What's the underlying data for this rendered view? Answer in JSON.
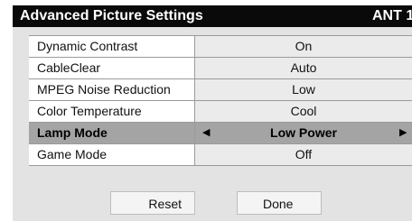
{
  "menu": {
    "title": "Advanced Picture Settings",
    "input_label": "ANT 1",
    "rows": [
      {
        "label": "Dynamic Contrast",
        "value": "On"
      },
      {
        "label": "CableClear",
        "value": "Auto"
      },
      {
        "label": "MPEG Noise Reduction",
        "value": "Low"
      },
      {
        "label": "Color Temperature",
        "value": "Cool"
      },
      {
        "label": "Lamp Mode",
        "value": "Low Power"
      },
      {
        "label": "Game Mode",
        "value": "Off"
      }
    ],
    "selected_row": "Lamp Mode",
    "buttons": {
      "reset": "Reset",
      "done": "Done"
    }
  },
  "colors": {
    "title_bar": "#0a0a0a",
    "panel": "#e3e3e3",
    "selected_row": "#a4a4a4"
  },
  "icons": {
    "left": "triangle-left-icon",
    "right": "triangle-right-icon"
  }
}
